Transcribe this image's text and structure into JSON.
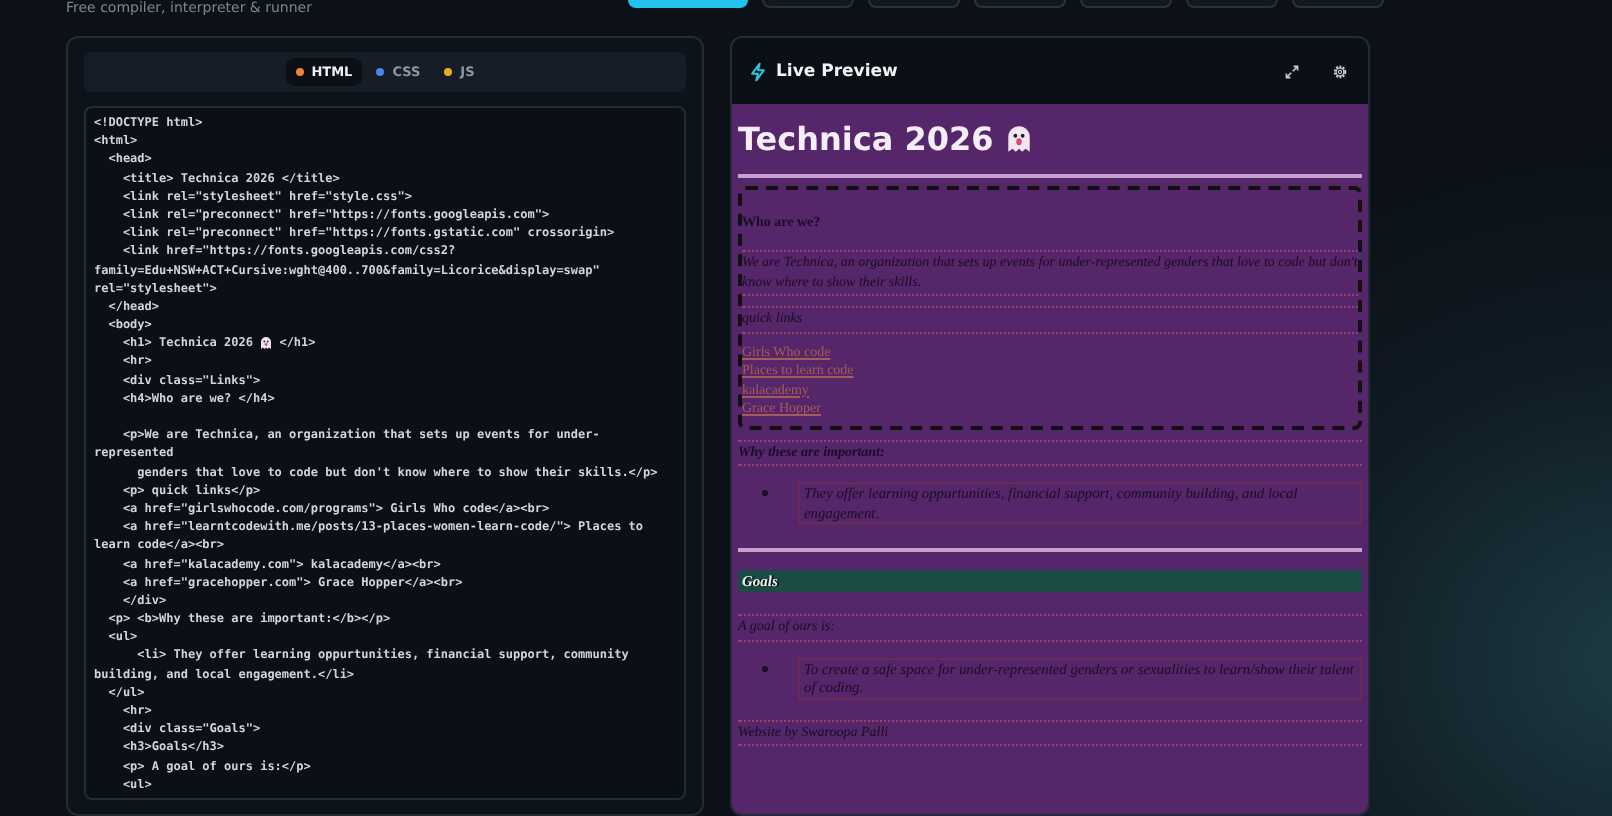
{
  "header": {
    "subtitle": "Free compiler, interpreter & runner",
    "nav_buttons": [
      {
        "selected": true
      },
      {
        "selected": false
      },
      {
        "selected": false
      },
      {
        "selected": false
      },
      {
        "selected": false
      },
      {
        "selected": false
      },
      {
        "selected": false
      }
    ]
  },
  "editor": {
    "tabs": [
      {
        "label": "HTML",
        "color": "#f0803c",
        "selected": true
      },
      {
        "label": "CSS",
        "color": "#4a86f0",
        "selected": false
      },
      {
        "label": "JS",
        "color": "#e8b020",
        "selected": false
      }
    ],
    "code_lines": [
      {
        "kind": "text",
        "text": "<!DOCTYPE html>"
      },
      {
        "kind": "text",
        "text": "<html>"
      },
      {
        "kind": "text",
        "text": "  <head>"
      },
      {
        "kind": "text",
        "text": "    <title> Technica 2026 </title>"
      },
      {
        "kind": "text",
        "text": "    <link rel=\"stylesheet\" href=\"style.css\">"
      },
      {
        "kind": "text",
        "text": "    <link rel=\"preconnect\" href=\"https://fonts.googleapis.com\">"
      },
      {
        "kind": "text",
        "text": "    <link rel=\"preconnect\" href=\"https://fonts.gstatic.com\" crossorigin>"
      },
      {
        "kind": "text",
        "text": "    <link href=\"https://fonts.googleapis.com/css2?"
      },
      {
        "kind": "text",
        "text": "family=Edu+NSW+ACT+Cursive:wght@400..700&family=Licorice&display=swap\""
      },
      {
        "kind": "text",
        "text": "rel=\"stylesheet\">"
      },
      {
        "kind": "text",
        "text": "  </head>"
      },
      {
        "kind": "text",
        "text": "  <body>"
      },
      {
        "kind": "ghost",
        "before": "    <h1> Technica 2026 ",
        "after": " </h1>"
      },
      {
        "kind": "text",
        "text": "    <hr>"
      },
      {
        "kind": "text",
        "text": "    <div class=\"Links\">"
      },
      {
        "kind": "text",
        "text": "    <h4>Who are we? </h4>"
      },
      {
        "kind": "blank"
      },
      {
        "kind": "text",
        "text": "    <p>We are Technica, an organization that sets up events for under-"
      },
      {
        "kind": "text",
        "text": "represented"
      },
      {
        "kind": "text",
        "text": "      genders that love to code but don't know where to show their skills.</p>"
      },
      {
        "kind": "text",
        "text": "    <p> quick links</p>"
      },
      {
        "kind": "text",
        "text": "    <a href=\"girlswhocode.com/programs\"> Girls Who code</a><br>"
      },
      {
        "kind": "text",
        "text": "    <a href=\"learntcodewith.me/posts/13-places-women-learn-code/\"> Places to"
      },
      {
        "kind": "text",
        "text": "learn code</a><br>"
      },
      {
        "kind": "text",
        "text": "    <a href=\"kalacademy.com\"> kalacademy</a><br>"
      },
      {
        "kind": "text",
        "text": "    <a href=\"gracehopper.com\"> Grace Hopper</a><br>"
      },
      {
        "kind": "text",
        "text": "    </div>"
      },
      {
        "kind": "text",
        "text": "  <p> <b>Why these are important:</b></p>"
      },
      {
        "kind": "text",
        "text": "  <ul>"
      },
      {
        "kind": "text",
        "text": "      <li> They offer learning oppurtunities, financial support, community"
      },
      {
        "kind": "text",
        "text": "building, and local engagement.</li>"
      },
      {
        "kind": "text",
        "text": "  </ul>"
      },
      {
        "kind": "text",
        "text": "    <hr>"
      },
      {
        "kind": "text",
        "text": "    <div class=\"Goals\">"
      },
      {
        "kind": "text",
        "text": "    <h3>Goals</h3>"
      },
      {
        "kind": "text",
        "text": "    <p> A goal of ours is:</p>"
      },
      {
        "kind": "text",
        "text": "    <ul>"
      }
    ]
  },
  "preview": {
    "title": "Live Preview",
    "heading": "Technica 2026",
    "links_box": {
      "heading": "Who are we?",
      "paragraph": "We are Technica, an organization that sets up events for under-represented genders that love to code but don't know where to show their skills.",
      "label": "quick links",
      "links": [
        "Girls Who code",
        "Places to learn code",
        "kalacademy",
        "Grace Hopper"
      ]
    },
    "important_label": "Why these are important:",
    "important_items": [
      "They offer learning oppurtunities, financial support, community building, and local engagement."
    ],
    "goals_heading": "Goals",
    "goals_label": "A goal of ours is:",
    "goals_items": [
      "To create a safe space for under-represented genders or sexualities to learn/show their talent of coding."
    ],
    "footer": "Website by Swaroopa Palli"
  }
}
